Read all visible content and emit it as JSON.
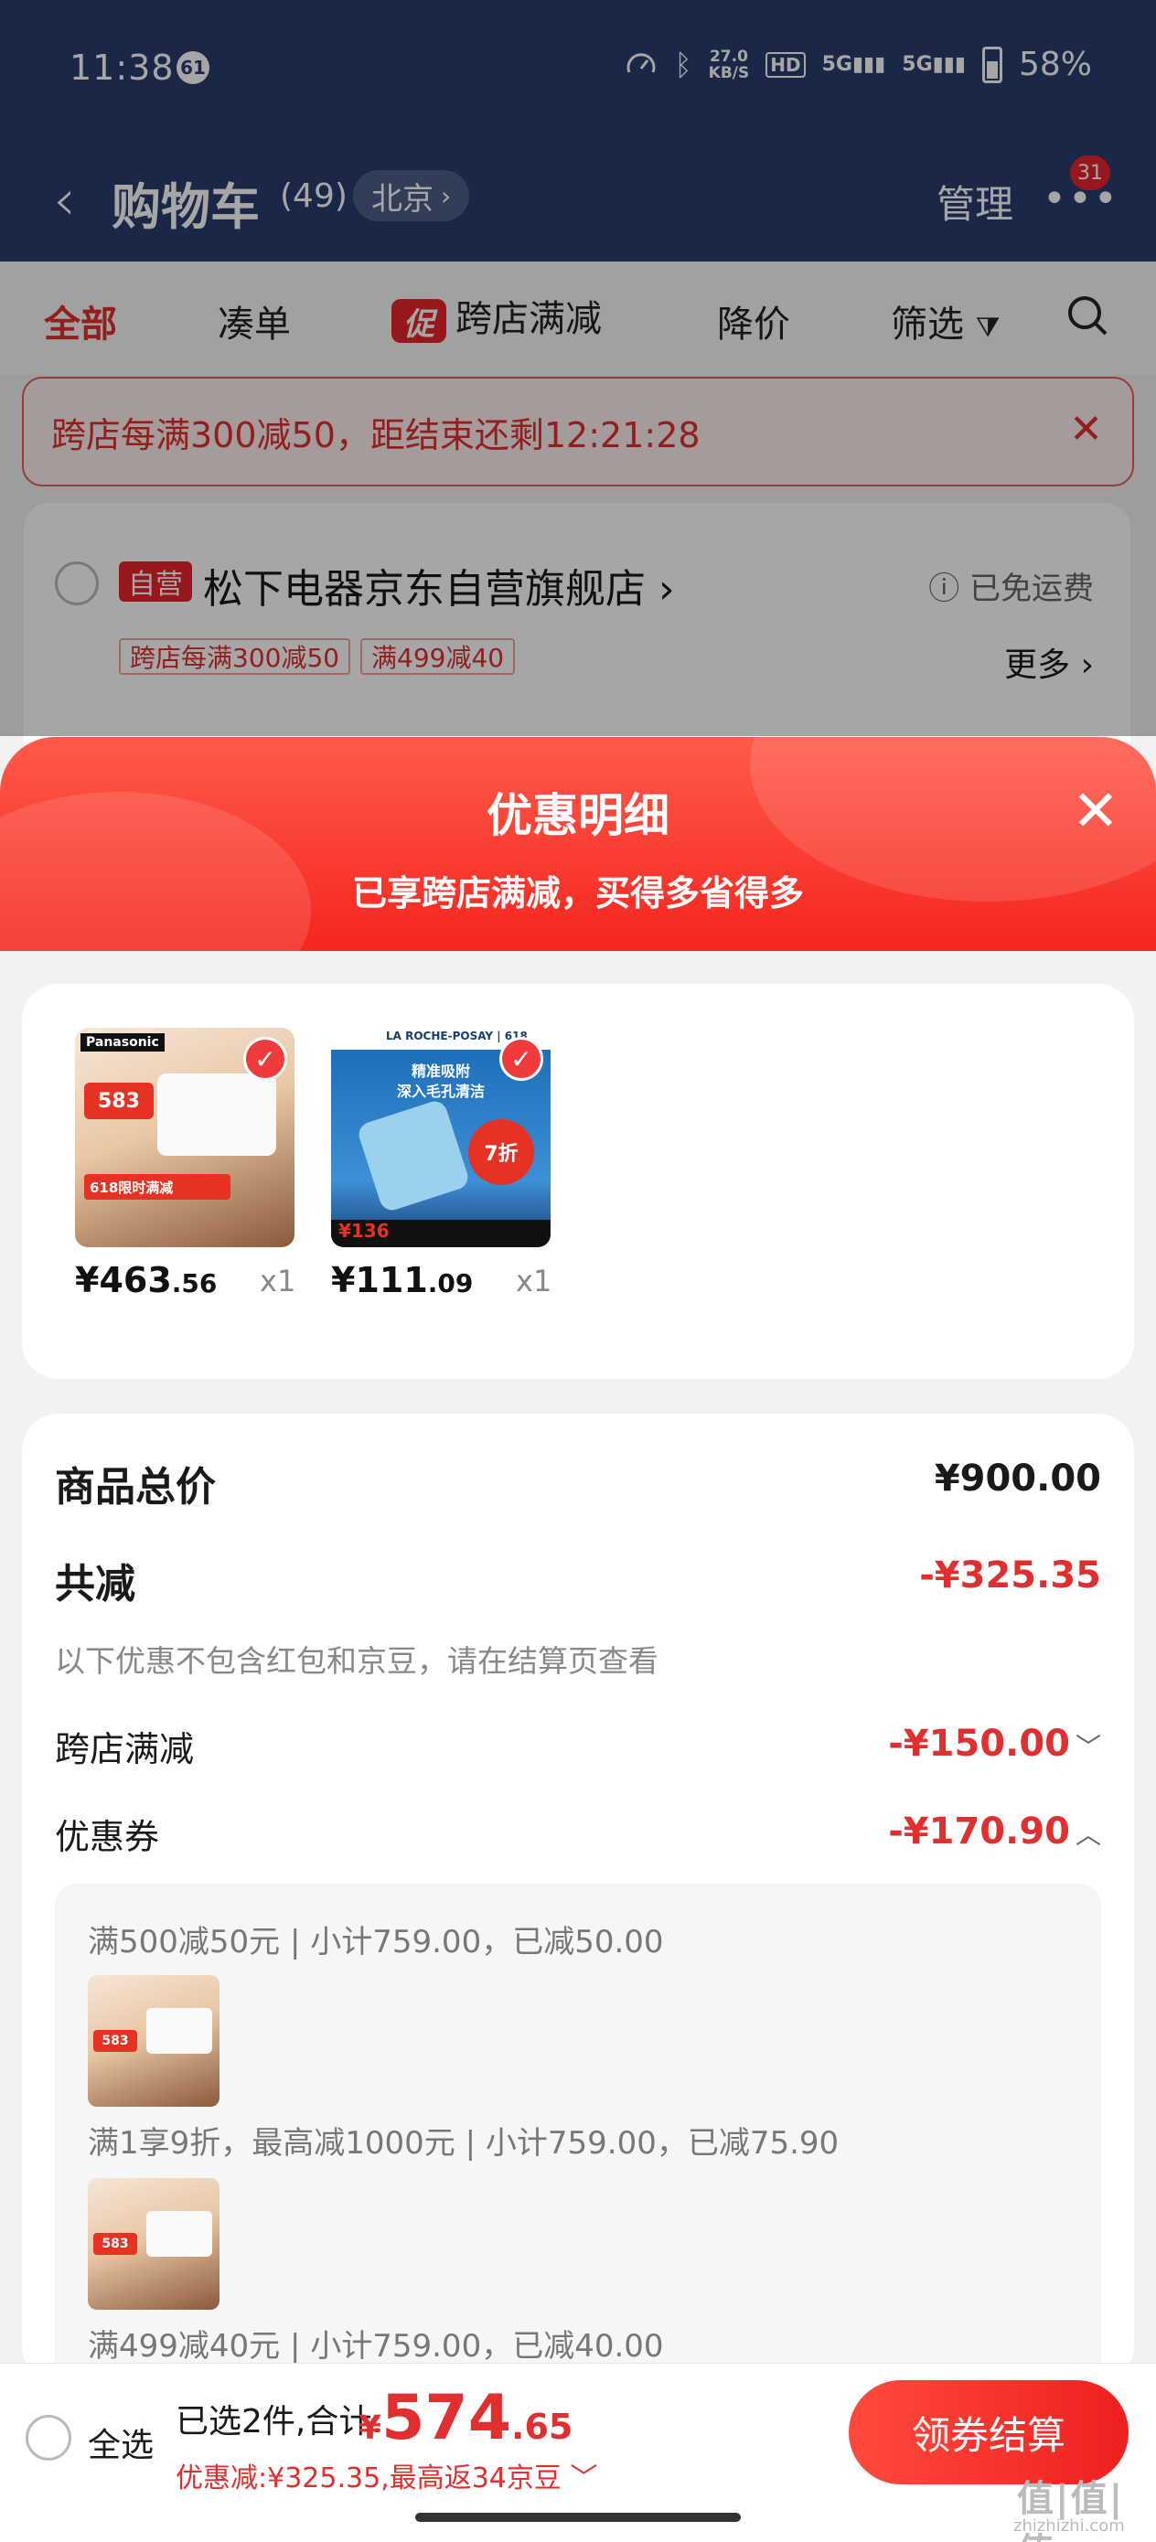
{
  "status_bar": {
    "time": "11:38",
    "notification_count": "61",
    "net_speed": "27.0",
    "net_unit": "KB/S",
    "hd_label": "HD",
    "signal1": "5G",
    "signal2": "5G",
    "battery": "58%"
  },
  "nav": {
    "title": "购物车",
    "count": "(49)",
    "location": "北京",
    "manage": "管理",
    "more_badge": "31"
  },
  "filters": {
    "all": "全部",
    "combine": "凑单",
    "promo_chip": "促",
    "cross_store": "跨店满减",
    "price_drop": "降价",
    "filter": "筛选"
  },
  "banner": {
    "text": "跨店每满300减50，距结束还剩12:21:28"
  },
  "store": {
    "self_tag": "自营",
    "name": "松下电器京东自营旗舰店",
    "shipping": "已免运费",
    "tags": [
      "跨店每满300减50",
      "满499减40"
    ],
    "more": "更多"
  },
  "sheet": {
    "title": "优惠明细",
    "subtitle": "已享跨店满减，买得多省得多"
  },
  "products": [
    {
      "price_int": "¥463",
      "price_dec": ".56",
      "qty": "x1"
    },
    {
      "price_int": "¥111",
      "price_dec": ".09",
      "qty": "x1"
    }
  ],
  "product_image_text": {
    "p1_brand": "Panasonic",
    "p1_price": "583",
    "p1_promo": "618限时满减",
    "p2_brand": "LA ROCHE-POSAY",
    "p2_tag": "618",
    "p2_line1": "精准吸附",
    "p2_line2": "深入毛孔清洁",
    "p2_discount": "7折",
    "p2_price": "136"
  },
  "summary": {
    "total_label": "商品总价",
    "total_value": "¥900.00",
    "reduce_label": "共减",
    "reduce_value": "-¥325.35",
    "note": "以下优惠不包含红包和京豆，请在结算页查看",
    "cross_label": "跨店满减",
    "cross_value": "-¥150.00",
    "coupon_label": "优惠券",
    "coupon_value": "-¥170.90"
  },
  "coupons": [
    {
      "text": "满500减50元 | 小计759.00，已减50.00"
    },
    {
      "text": "满1享9折，最高减1000元 | 小计759.00，已减75.90"
    },
    {
      "text": "满499减40元 | 小计759.00，已减40.00"
    }
  ],
  "bottom": {
    "select_all": "全选",
    "selected_text": "已选2件,合计:",
    "total_sym": "¥",
    "total_int": "574",
    "total_dec": ".65",
    "savings": "优惠减:¥325.35,最高返34京豆",
    "checkout": "领券结算"
  },
  "watermark": {
    "text": "值|值|值",
    "sub": "zhizhizhi.com"
  },
  "colors": {
    "nav_bg": "#283c6c",
    "accent": "#e12e2e"
  }
}
